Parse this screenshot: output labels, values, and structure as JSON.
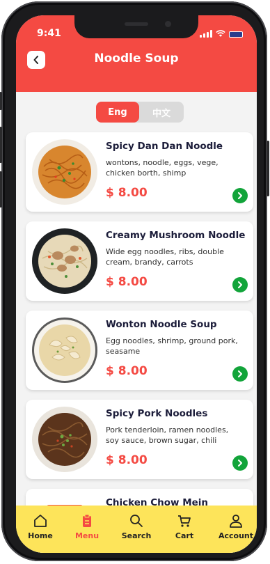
{
  "status_bar": {
    "time": "9:41"
  },
  "header": {
    "title": "Noodle Soup"
  },
  "language_toggle": {
    "options": [
      "Eng",
      "中文"
    ],
    "selected": "Eng"
  },
  "menu_items": [
    {
      "name": "Spicy Dan Dan Noodle",
      "description": "wontons, noodle, eggs, vege, chicken borth, shimp",
      "price": "$ 8.00"
    },
    {
      "name": "Creamy Mushroom Noodle",
      "description": "Wide egg noodles, ribs, double cream, brandy, carrots",
      "price": "$ 8.00"
    },
    {
      "name": "Wonton Noodle Soup",
      "description": "Egg noodles, shrimp, ground pork, seasame",
      "price": "$ 8.00"
    },
    {
      "name": "Spicy Pork Noodles",
      "description": "Pork tenderloin, ramen noodles, soy sauce, brown sugar, chili",
      "price": "$ 8.00"
    },
    {
      "name": "Chicken Chow Mein",
      "description": "",
      "price": ""
    }
  ],
  "tab_bar": {
    "tabs": [
      {
        "label": "Home",
        "icon": "home-icon"
      },
      {
        "label": "Menu",
        "icon": "clipboard-icon"
      },
      {
        "label": "Search",
        "icon": "search-icon"
      },
      {
        "label": "Cart",
        "icon": "cart-icon"
      },
      {
        "label": "Account",
        "icon": "user-icon"
      }
    ],
    "active": "Menu"
  },
  "colors": {
    "accent": "#f44a43",
    "tab_bar": "#fde45a",
    "go_button": "#12a43a",
    "title_text": "#1c1d3a"
  }
}
